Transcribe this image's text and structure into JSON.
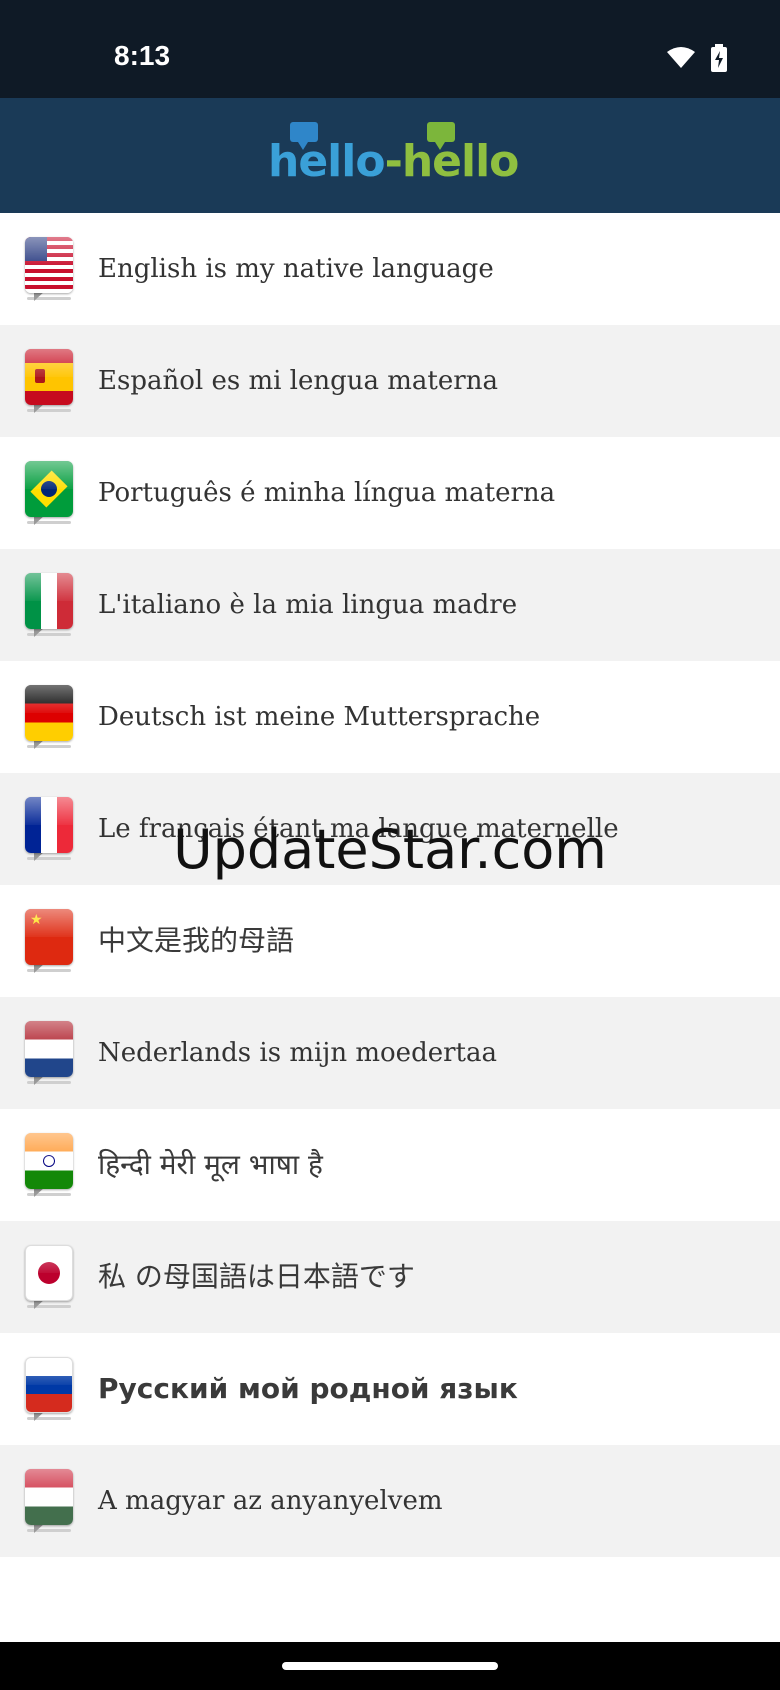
{
  "status_bar": {
    "time": "8:13"
  },
  "header": {
    "logo_part1": "hello",
    "logo_dash": "-",
    "logo_part2": "hello"
  },
  "languages": [
    {
      "flag": "us-flag-icon",
      "label": "English is my native language"
    },
    {
      "flag": "spain-flag-icon",
      "label": "Español es mi lengua materna"
    },
    {
      "flag": "brazil-flag-icon",
      "label": "Português é minha língua materna"
    },
    {
      "flag": "italy-flag-icon",
      "label": "L'italiano è la mia lingua madre"
    },
    {
      "flag": "germany-flag-icon",
      "label": "Deutsch ist meine Muttersprache"
    },
    {
      "flag": "france-flag-icon",
      "label": "Le français étant ma langue maternelle"
    },
    {
      "flag": "china-flag-icon",
      "label": "中文是我的母語"
    },
    {
      "flag": "netherlands-flag-icon",
      "label": "Nederlands is mijn moedertaa"
    },
    {
      "flag": "india-flag-icon",
      "label": "हिन्दी मेरी मूल भाषा है"
    },
    {
      "flag": "japan-flag-icon",
      "label": "私 の母国語は日本語です"
    },
    {
      "flag": "russia-flag-icon",
      "label": "Русский мой родной язык"
    },
    {
      "flag": "hungary-flag-icon",
      "label": "A magyar az anyanyelvem"
    }
  ],
  "watermark": "UpdateStar.com"
}
